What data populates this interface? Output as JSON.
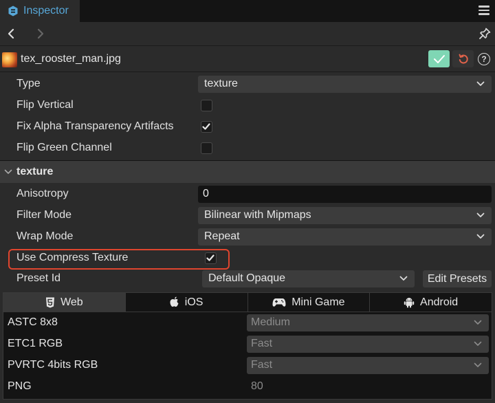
{
  "tabbar": {
    "tab_label": "Inspector",
    "icon": "inspector-icon",
    "menu_icon": "hamburger-menu-icon",
    "accent_color": "#57a7d8"
  },
  "navbar": {
    "back_icon": "chevron-left-icon",
    "forward_icon": "chevron-right-icon",
    "pin_icon": "pin-icon"
  },
  "asset": {
    "name": "tex_rooster_man.jpg",
    "thumbnail": "image-thumbnail",
    "apply_icon": "checkmark-icon",
    "revert_icon": "revert-icon",
    "help_label": "?",
    "apply_color": "#7fd6b4",
    "revert_color": "#e0624a"
  },
  "properties": {
    "type": {
      "label": "Type",
      "value": "texture"
    },
    "flip_vertical": {
      "label": "Flip Vertical",
      "checked": false
    },
    "fix_alpha": {
      "label": "Fix Alpha Transparency Artifacts",
      "checked": true
    },
    "flip_green": {
      "label": "Flip Green Channel",
      "checked": false
    }
  },
  "texture_section": {
    "title": "texture",
    "anisotropy": {
      "label": "Anisotropy",
      "value": "0"
    },
    "filter_mode": {
      "label": "Filter Mode",
      "value": "Bilinear with Mipmaps"
    },
    "wrap_mode": {
      "label": "Wrap Mode",
      "value": "Repeat"
    },
    "use_compress": {
      "label": "Use Compress Texture",
      "checked": true,
      "highlight_color": "#e0452e"
    },
    "preset_id": {
      "label": "Preset Id",
      "value": "Default Opaque"
    },
    "edit_presets_label": "Edit Presets"
  },
  "platforms": {
    "tabs": [
      {
        "label": "Web",
        "icon": "html5-icon",
        "active": true
      },
      {
        "label": "iOS",
        "icon": "apple-icon",
        "active": false
      },
      {
        "label": "Mini Game",
        "icon": "gamepad-icon",
        "active": false
      },
      {
        "label": "Android",
        "icon": "android-icon",
        "active": false
      }
    ],
    "rows": [
      {
        "label": "ASTC 8x8",
        "value": "Medium"
      },
      {
        "label": "ETC1 RGB",
        "value": "Fast"
      },
      {
        "label": "PVRTC 4bits RGB",
        "value": "Fast"
      },
      {
        "label": "PNG",
        "value": "80"
      }
    ]
  }
}
